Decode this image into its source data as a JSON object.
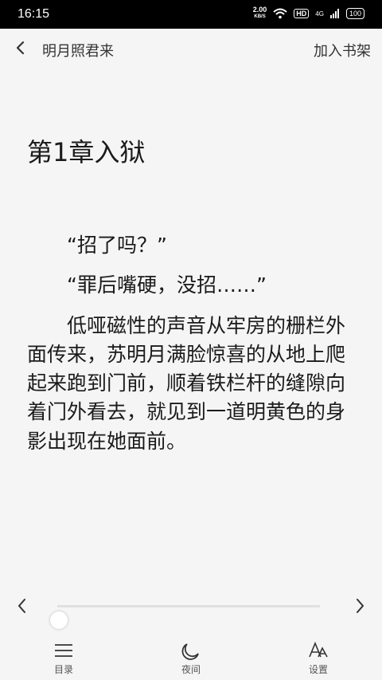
{
  "status_bar": {
    "time": "16:15",
    "net_speed_value": "2.00",
    "net_speed_unit": "KB/S",
    "hd": "HD",
    "network": "4G",
    "battery": "100"
  },
  "header": {
    "book_title": "明月照君来",
    "add_to_shelf": "加入书架"
  },
  "chapter": {
    "title": "第1章入狱",
    "paragraphs": [
      "“招了吗？”",
      "“罪后嘴硬，没招……”",
      "低哑磁性的声音从牢房的栅栏外面传来，苏明月满脸惊喜的从地上爬起来跑到门前，顺着铁栏杆的缝隙向着门外看去，就见到一道明黄色的身影出现在她面前。"
    ]
  },
  "progress": {
    "value": 0.0
  },
  "bottom_nav": {
    "catalog": "目录",
    "night": "夜间",
    "settings": "设置"
  },
  "icons": {
    "back": "chevron-left-icon",
    "prev": "chevron-left-icon",
    "next": "chevron-right-icon",
    "catalog": "menu-icon",
    "night": "moon-icon",
    "settings": "font-icon"
  }
}
